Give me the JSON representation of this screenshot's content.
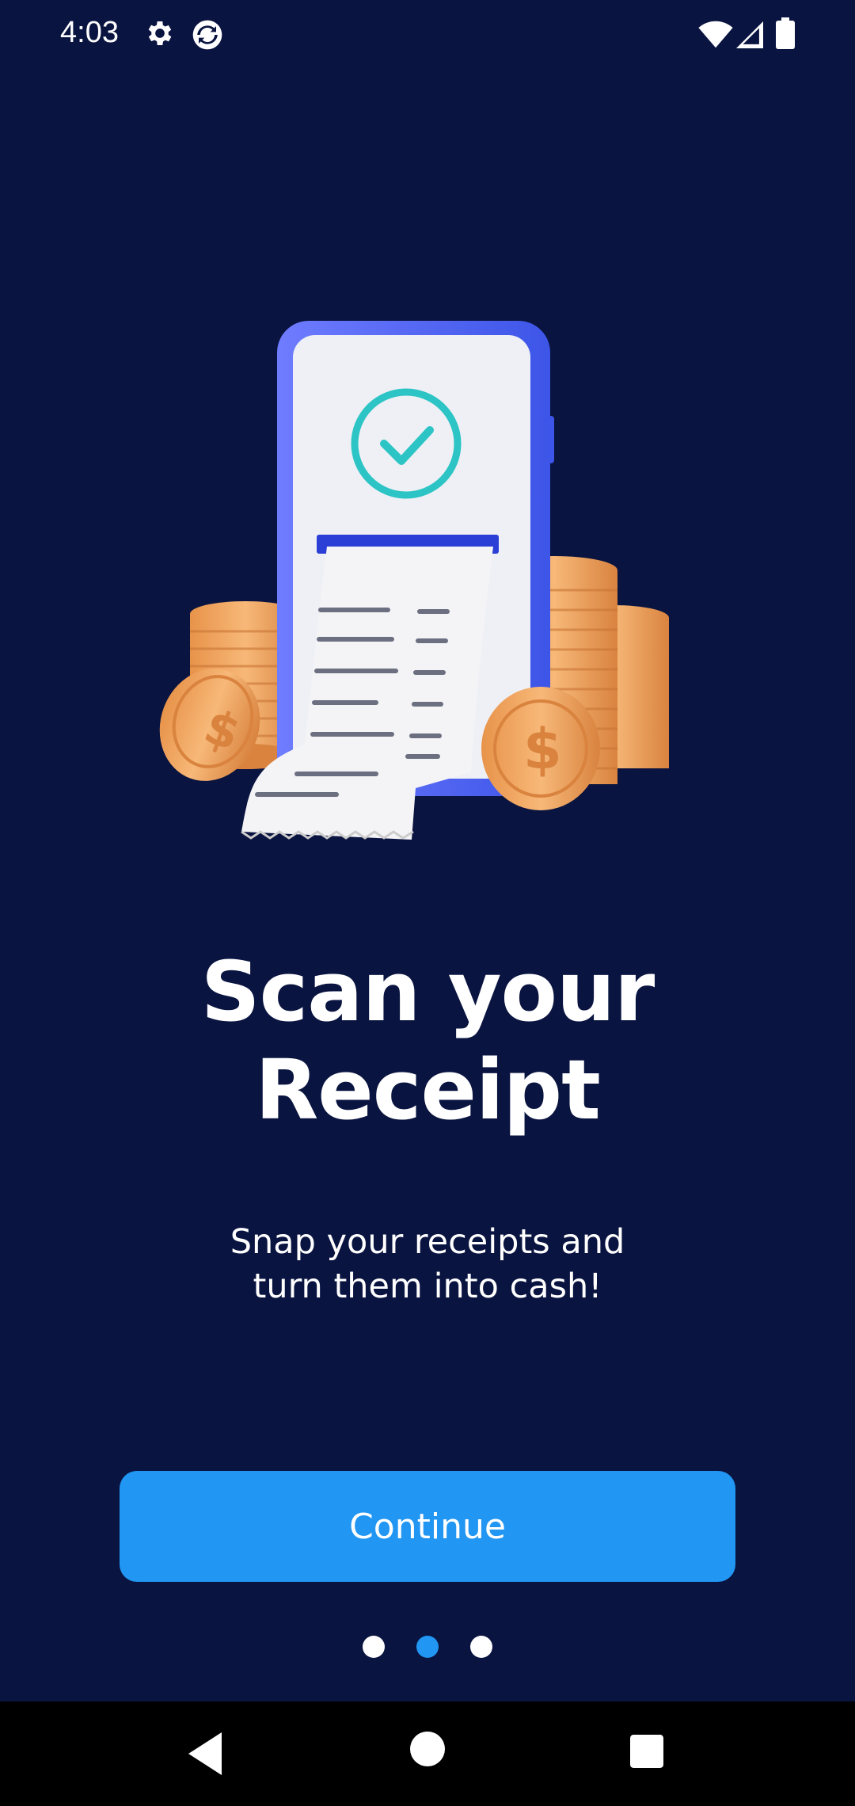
{
  "status_bar": {
    "time": "4:03",
    "icons_left": [
      "settings-icon",
      "sync-icon"
    ],
    "icons_right": [
      "wifi-icon",
      "cell-signal-icon",
      "battery-icon"
    ]
  },
  "onboarding": {
    "illustration": "phone-receipt-coins",
    "title_line1": "Scan your",
    "title_line2": "Receipt",
    "subtitle_line1": "Snap your receipts and",
    "subtitle_line2": "turn them into cash!",
    "continue_label": "Continue",
    "page_count": 3,
    "active_page": 2
  },
  "nav_bar": {
    "buttons": [
      "back-icon",
      "home-icon",
      "recents-icon"
    ]
  },
  "colors": {
    "background": "#0a1440",
    "accent": "#2196f3",
    "coin": "#f0a45a",
    "phone": "#4a6cf7"
  }
}
